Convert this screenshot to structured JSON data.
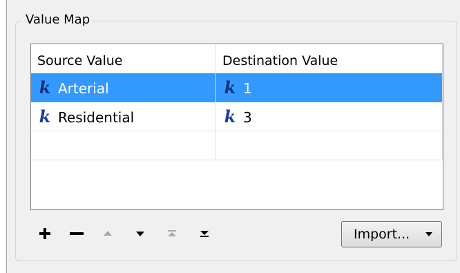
{
  "groupbox": {
    "title": "Value Map"
  },
  "table": {
    "headers": {
      "source": "Source Value",
      "destination": "Destination Value"
    },
    "rows": [
      {
        "source": "Arterial",
        "destination": "1",
        "selected": true
      },
      {
        "source": "Residential",
        "destination": "3",
        "selected": false
      },
      {
        "source": "",
        "destination": "",
        "selected": false
      }
    ]
  },
  "icons": {
    "value_type": "k-constant-icon"
  },
  "toolbar": {
    "add": "plus-icon",
    "remove": "minus-icon",
    "move_up": "arrow-up-icon",
    "move_down": "arrow-down-icon",
    "move_top": "move-to-top-icon",
    "move_bottom": "move-to-bottom-icon"
  },
  "import_button": {
    "label": "Import..."
  },
  "colors": {
    "selection": "#3399ff",
    "icon": "#1a3fa0"
  }
}
